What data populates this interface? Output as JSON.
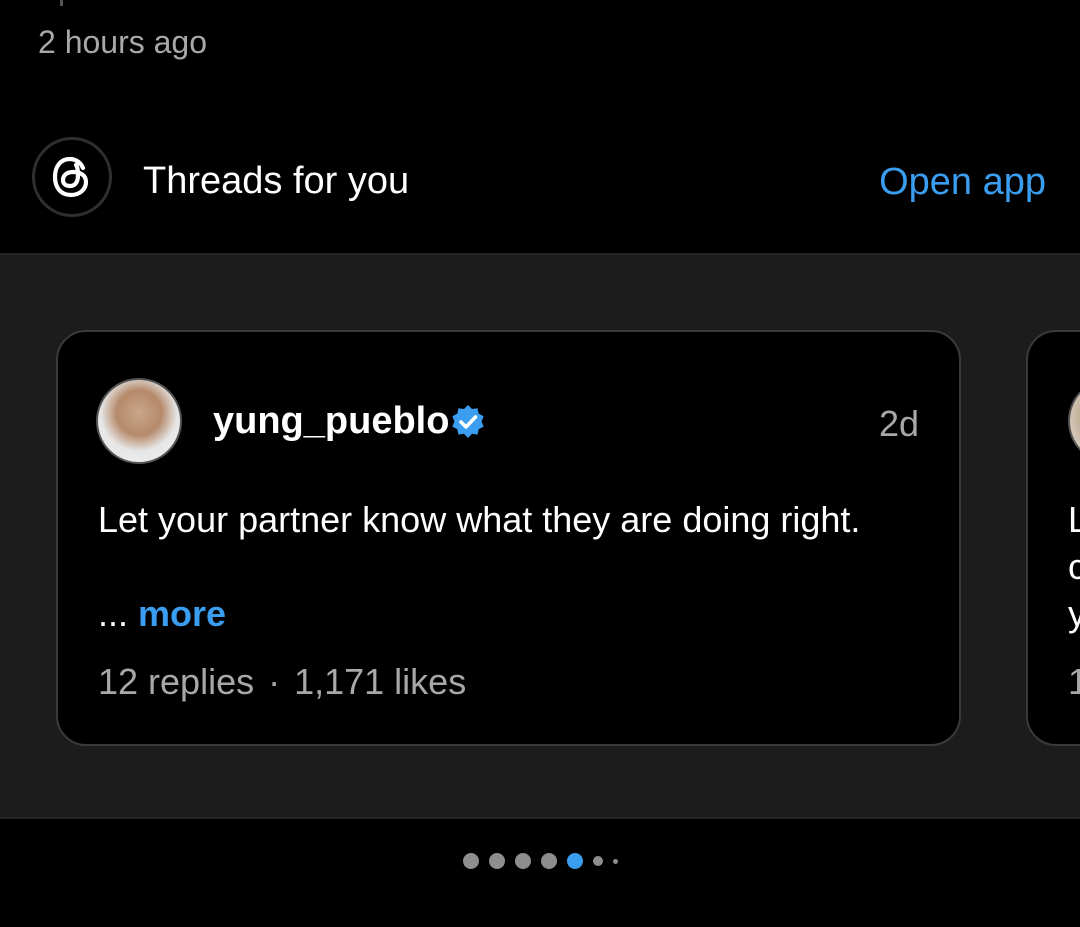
{
  "notification": {
    "timestamp": "2 hours ago"
  },
  "section": {
    "title": "Threads for you",
    "action_label": "Open app"
  },
  "cards": [
    {
      "username": "yung_pueblo",
      "verified": true,
      "time_ago": "2d",
      "text": "Let your partner know what they are doing right.",
      "ellipsis": "...",
      "more_label": "more",
      "replies": "12 replies",
      "separator": "·",
      "likes": "1,171 likes"
    },
    {
      "peek_lines": [
        "L",
        "c",
        "y"
      ],
      "peek_stats": "1"
    }
  ],
  "pager": {
    "count": 7,
    "active_index": 4
  },
  "colors": {
    "accent": "#3a9df0",
    "background": "#000000",
    "band": "#1c1c1c",
    "muted_text": "#a8a8a8"
  },
  "icons": {
    "logo": "threads-logo-icon",
    "verified": "verified-badge-icon"
  }
}
